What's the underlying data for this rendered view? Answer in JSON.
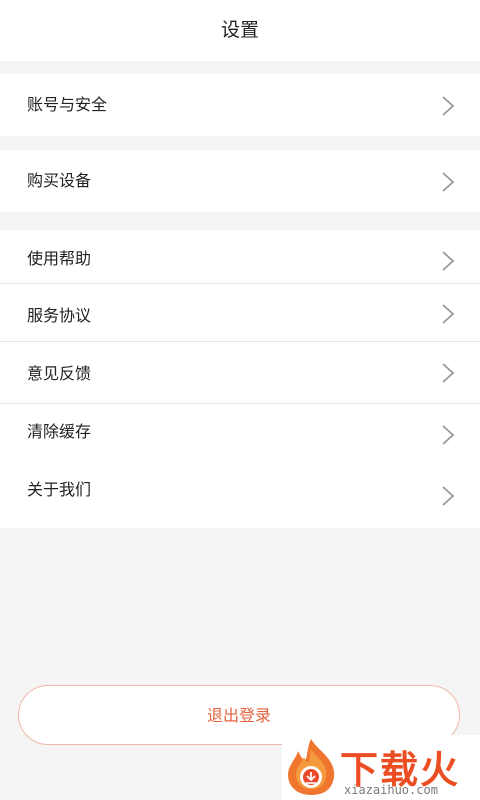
{
  "header": {
    "title": "设置"
  },
  "groups": [
    {
      "items": [
        {
          "label": "账号与安全"
        }
      ]
    },
    {
      "items": [
        {
          "label": "购买设备"
        }
      ]
    },
    {
      "items": [
        {
          "label": "使用帮助"
        },
        {
          "label": "服务协议"
        },
        {
          "label": "意见反馈"
        },
        {
          "label": "清除缓存"
        },
        {
          "label": "关于我们"
        }
      ]
    }
  ],
  "logout": {
    "label": "退出登录"
  },
  "watermark": {
    "brand": "下载火",
    "url": "xiazaihuo.com"
  },
  "colors": {
    "accent": "#e5623d",
    "background": "#f5f5f5",
    "card": "#ffffff",
    "divider": "#e6e6e6"
  }
}
